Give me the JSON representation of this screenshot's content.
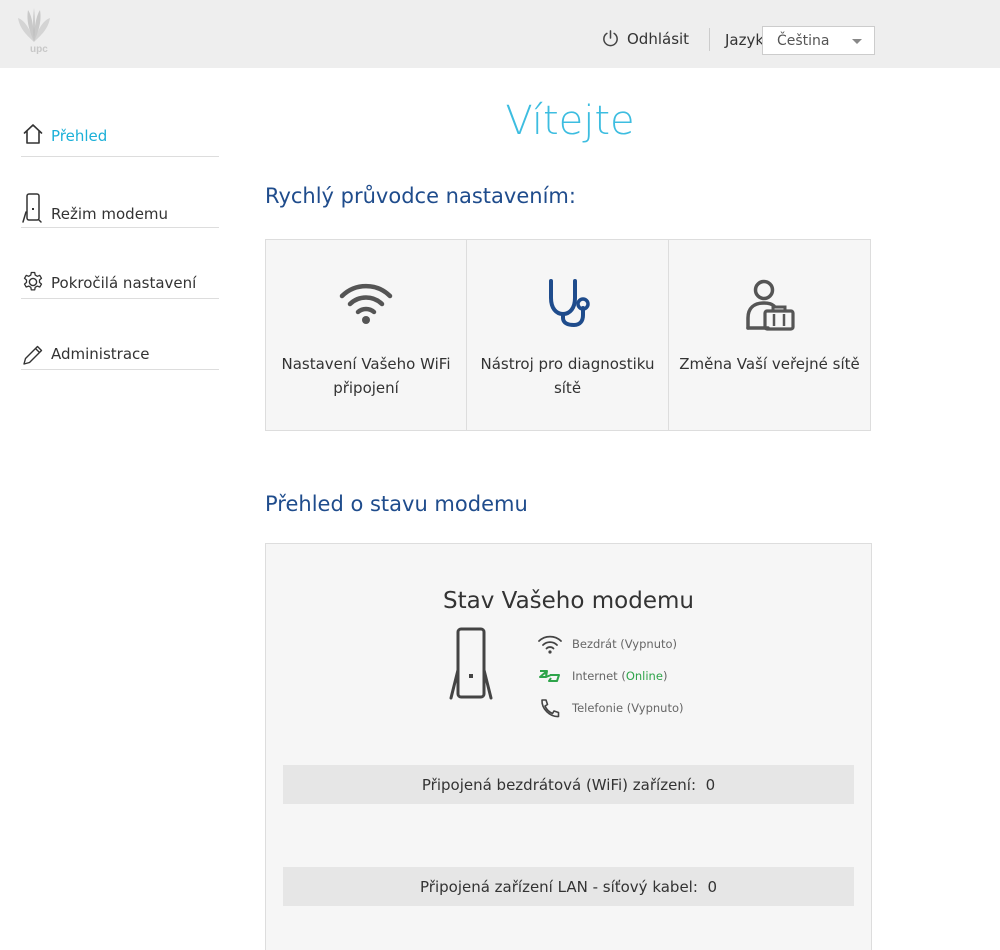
{
  "header": {
    "logo_text": "upc",
    "logout_label": "Odhlásit",
    "language_label": "Jazyk",
    "language_value": "Čeština"
  },
  "sidebar": {
    "items": [
      {
        "label": "Přehled",
        "icon": "home-icon",
        "active": true
      },
      {
        "label": "Režim modemu",
        "icon": "modem-icon",
        "active": false
      },
      {
        "label": "Pokročilá nastavení",
        "icon": "gear-icon",
        "active": false
      },
      {
        "label": "Administrace",
        "icon": "pencil-icon",
        "active": false
      }
    ]
  },
  "main": {
    "welcome": "Vítejte",
    "quick_guide_title": "Rychlý průvodce nastavením:",
    "quick_cards": [
      {
        "label": "Nastavení Vašeho WiFi připojení",
        "icon": "wifi-icon"
      },
      {
        "label": "Nástroj pro diagnostiku sítě",
        "icon": "stethoscope-icon"
      },
      {
        "label": "Změna Vaší veřejné sítě",
        "icon": "user-briefcase-icon"
      }
    ],
    "status_section_title": "Přehled o stavu modemu",
    "status": {
      "title": "Stav Vašeho modemu",
      "wireless_label": "Bezdrát",
      "wireless_state": "Vypnuto",
      "internet_label": "Internet",
      "internet_state": "Online",
      "phone_label": "Telefonie",
      "phone_state": "Vypnuto",
      "wifi_devices_label": "Připojená bezdrátová (WiFi) zařízení:",
      "wifi_devices_count": "0",
      "lan_devices_label": "Připojená zařízení LAN - síťový kabel:",
      "lan_devices_count": "0"
    }
  },
  "colors": {
    "accent": "#3dbde0",
    "active_nav": "#1bb0d8",
    "section_title": "#1f4c8c",
    "online": "#2ea44a",
    "header_bg": "#eeeeee",
    "card_bg": "#f6f6f6"
  }
}
